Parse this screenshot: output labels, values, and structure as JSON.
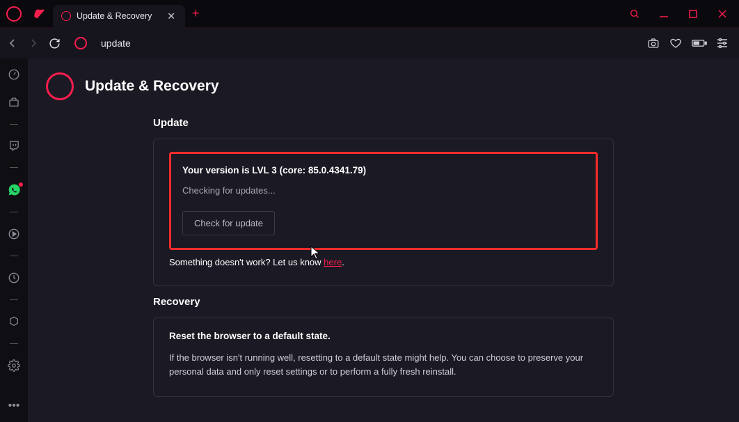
{
  "tab": {
    "title": "Update & Recovery"
  },
  "address": {
    "text": "update"
  },
  "page": {
    "title": "Update & Recovery"
  },
  "update": {
    "heading": "Update",
    "version_prefix": "Your version is",
    "version_level": "LVL 3",
    "version_core": "(core: 85.0.4341.79)",
    "status": "Checking for updates...",
    "button": "Check for update",
    "feedback_prefix": "Something doesn't work? Let us know ",
    "feedback_link": "here",
    "feedback_suffix": "."
  },
  "recovery": {
    "heading": "Recovery",
    "reset_title": "Reset the browser to a default state.",
    "reset_desc": "If the browser isn't running well, resetting to a default state might help. You can choose to preserve your personal data and only reset settings or to perform a fully fresh reinstall."
  }
}
